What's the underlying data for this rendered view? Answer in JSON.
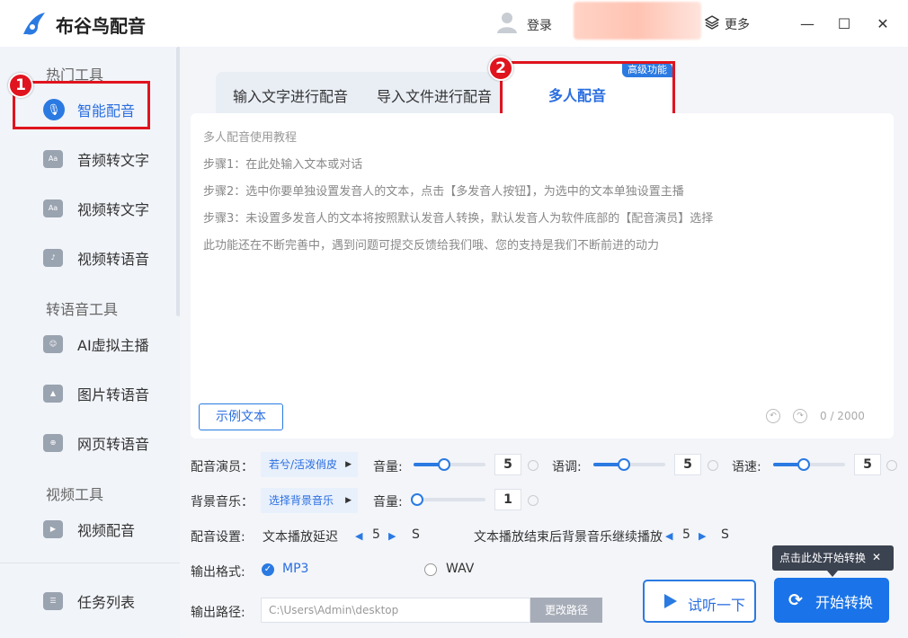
{
  "app": {
    "title": "布谷鸟配音"
  },
  "header": {
    "login": "登录",
    "more": "更多",
    "minimize": "—",
    "maximize": "☐",
    "close": "✕"
  },
  "sidebar": {
    "sections": [
      "热门工具",
      "转语音工具",
      "视频工具"
    ],
    "items": [
      {
        "label": "智能配音",
        "icon": "mic-icon"
      },
      {
        "label": "音频转文字",
        "icon": "audio-text-icon",
        "glyph": "Aa"
      },
      {
        "label": "视频转文字",
        "icon": "video-text-icon",
        "glyph": "Aa"
      },
      {
        "label": "视频转语音",
        "icon": "video-audio-icon",
        "glyph": "♪"
      },
      {
        "label": "AI虚拟主播",
        "icon": "avatar-host-icon",
        "glyph": "☺"
      },
      {
        "label": "图片转语音",
        "icon": "image-icon",
        "glyph": "▲"
      },
      {
        "label": "网页转语音",
        "icon": "globe-icon",
        "glyph": "⊕"
      },
      {
        "label": "视频配音",
        "icon": "video-dub-icon",
        "glyph": "▶"
      },
      {
        "label": "任务列表",
        "icon": "task-list-icon",
        "glyph": "☰"
      }
    ]
  },
  "annotations": {
    "badge1": "1",
    "badge2": "2"
  },
  "tabs": [
    {
      "label": "输入文字进行配音"
    },
    {
      "label": "导入文件进行配音"
    },
    {
      "label": "多人配音",
      "badge": "高级功能",
      "active": true
    }
  ],
  "editor": {
    "lines": [
      "多人配音使用教程",
      "步骤1：在此处输入文本或对话",
      "步骤2：选中你要单独设置发音人的文本，点击【多发音人按钮】，为选中的文本单独设置主播",
      "步骤3：未设置多发音人的文本将按照默认发音人转换，默认发音人为软件底部的【配音演员】选择",
      "此功能还在不断完善中，遇到问题可提交反馈给我们哦、您的支持是我们不断前进的动力"
    ],
    "sample_button": "示例文本",
    "char_count": "0 / 2000"
  },
  "settings": {
    "actor_label": "配音演员：",
    "actor_value": "若兮/活泼俏皮",
    "volume_label": "音量:",
    "volume_value": "5",
    "pitch_label": "语调:",
    "pitch_value": "5",
    "speed_label": "语速:",
    "speed_value": "5",
    "bgm_label": "背景音乐：",
    "bgm_value": "选择背景音乐",
    "bgm_volume_label": "音量:",
    "bgm_volume_value": "1",
    "config_label": "配音设置:",
    "delay_label": "文本播放延迟",
    "delay_value": "5",
    "delay_unit": "S",
    "continue_label": "文本播放结束后背景音乐继续播放",
    "continue_value": "5",
    "continue_unit": "S",
    "format_label": "输出格式:",
    "format_mp3": "MP3",
    "format_wav": "WAV",
    "path_label": "输出路径:",
    "path_value": "C:\\Users\\Admin\\desktop",
    "change_path": "更改路径"
  },
  "actions": {
    "preview": "试听一下",
    "start": "开始转换",
    "tooltip": "点击此处开始转换",
    "tooltip_close": "✕"
  },
  "colors": {
    "accent": "#2a7ae2",
    "annotation": "#e0141e"
  }
}
